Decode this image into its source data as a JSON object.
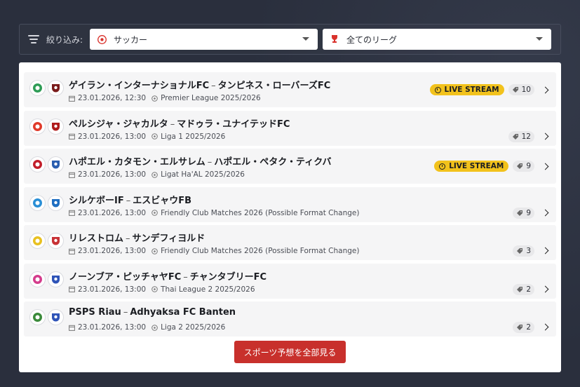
{
  "filter": {
    "label": "絞り込み:",
    "sport_value": "サッカー",
    "league_value": "全てのリーグ"
  },
  "colors": {
    "accent": "#c8302c",
    "live": "#f2c21c",
    "background": "#2a2f3d"
  },
  "matches": [
    {
      "title_home": "ゲイラン・インターナショナルFC",
      "title_away": "タンピネス・ローバーズFC",
      "datetime": "23.01.2026, 12:30",
      "league": "Premier League 2025/2026",
      "live": "LIVE STREAM",
      "tips": "10"
    },
    {
      "title_home": "ペルシジャ・ジャカルタ",
      "title_away": "マドゥラ・ユナイテッドFC",
      "datetime": "23.01.2026, 13:00",
      "league": "Liga 1 2025/2026",
      "live": "",
      "tips": "12"
    },
    {
      "title_home": "ハポエル・カタモン・エルサレム",
      "title_away": "ハポエル・ペタク・ティクバ",
      "datetime": "23.01.2026, 13:00",
      "league": "Ligat Ha'AL 2025/2026",
      "live": "LIVE STREAM",
      "tips": "9"
    },
    {
      "title_home": "シルケボーIF",
      "title_away": "エスビャウFB",
      "datetime": "23.01.2026, 13:00",
      "league": "Friendly Club Matches 2026 (Possible Format Change)",
      "live": "",
      "tips": "9"
    },
    {
      "title_home": "リレストロム",
      "title_away": "サンデフィヨルド",
      "datetime": "23.01.2026, 13:00",
      "league": "Friendly Club Matches 2026 (Possible Format Change)",
      "live": "",
      "tips": "3"
    },
    {
      "title_home": "ノーンブア・ピッチャヤFC",
      "title_away": "チャンタブリーFC",
      "datetime": "23.01.2026, 13:00",
      "league": "Thai League 2 2025/2026",
      "live": "",
      "tips": "2"
    },
    {
      "title_home": "PSPS Riau",
      "title_away": "Adhyaksa FC Banten",
      "datetime": "23.01.2026, 13:00",
      "league": "Liga 2 2025/2026",
      "live": "",
      "tips": "2"
    }
  ],
  "team_logo_colors": [
    [
      "#2e9c56",
      "#7a1b1b"
    ],
    [
      "#e03a2a",
      "#b01c1c"
    ],
    [
      "#c21e2a",
      "#2b5fb0"
    ],
    [
      "#2a8fd6",
      "#1f6fc2"
    ],
    [
      "#e8c020",
      "#c83236"
    ],
    [
      "#d43c8c",
      "#2f54b8"
    ],
    [
      "#3a8a3a",
      "#2f54b8"
    ]
  ],
  "cta": {
    "label": "スポーツ予想を全部見る"
  }
}
